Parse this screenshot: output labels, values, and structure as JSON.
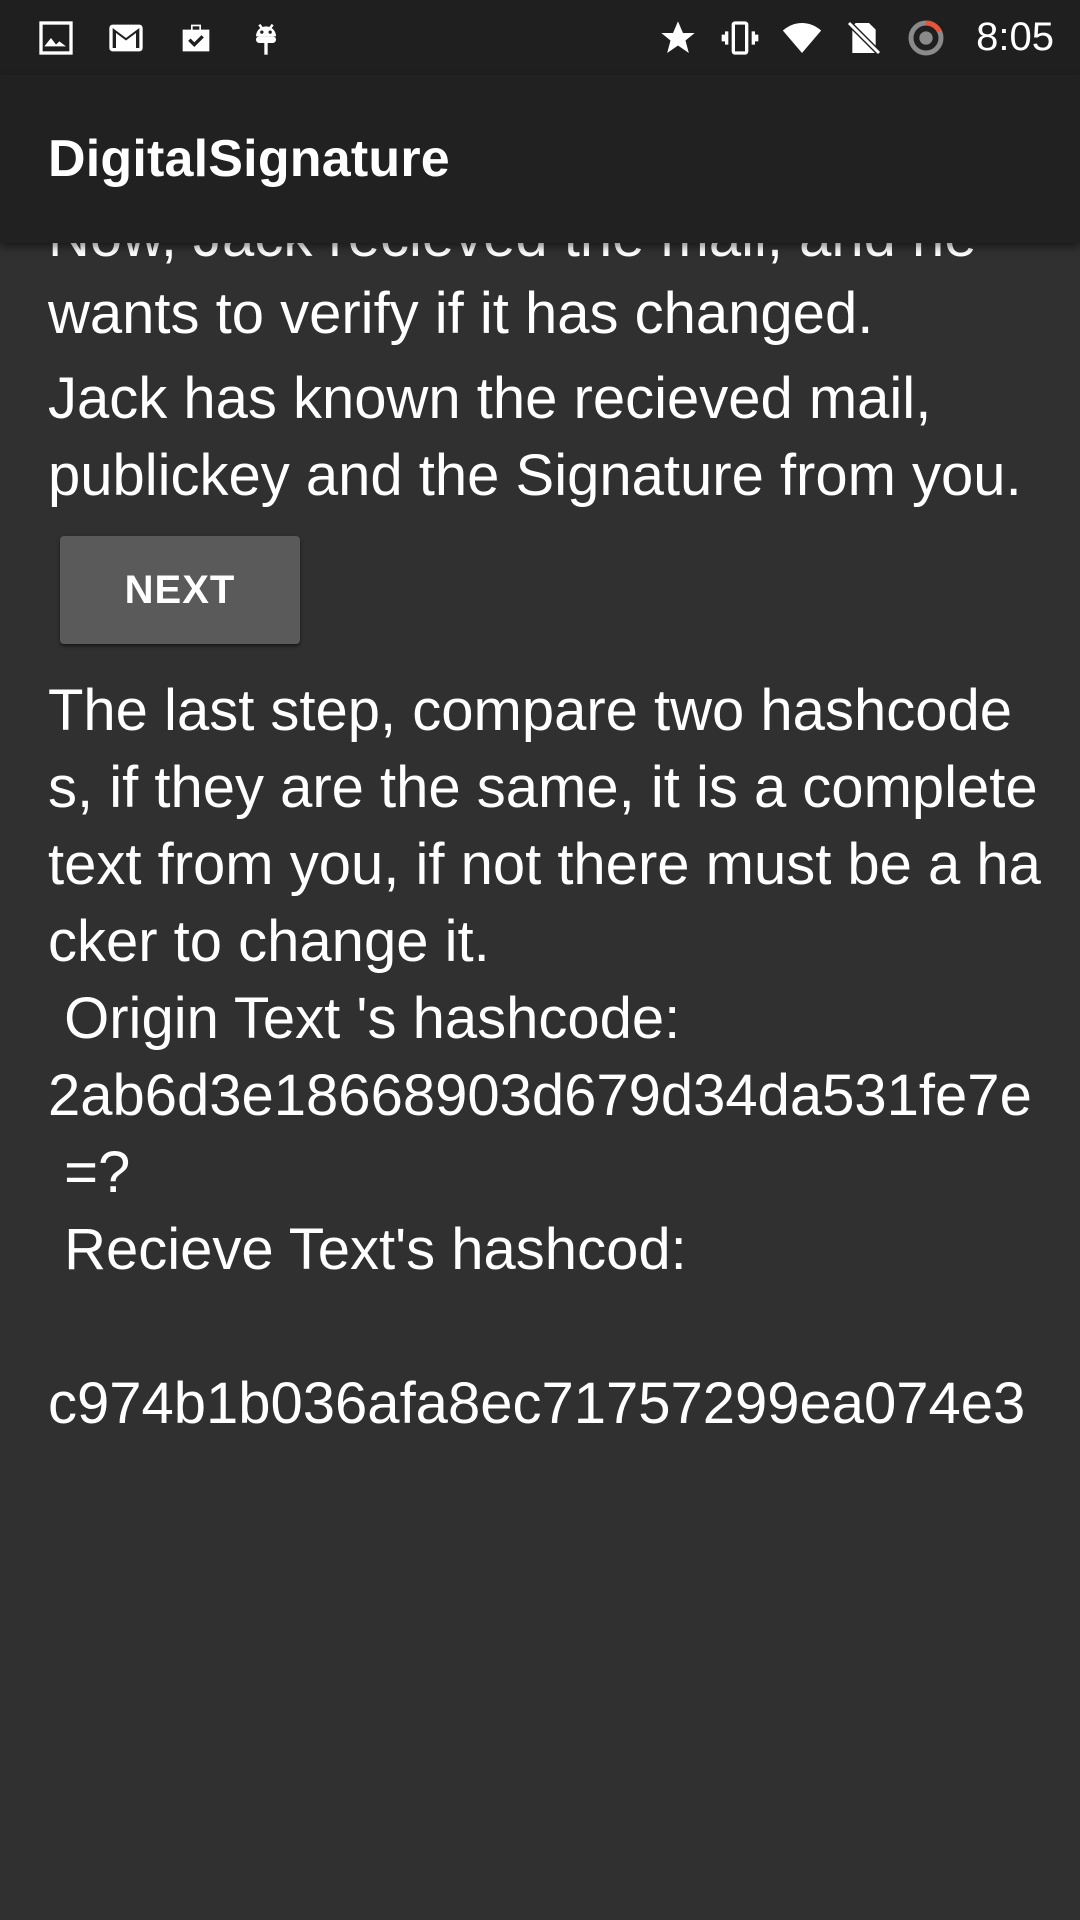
{
  "status_bar": {
    "time": "8:05",
    "left_icons": [
      "image-icon",
      "gmail-icon",
      "briefcase-check-icon",
      "android-icon"
    ],
    "right_icons": [
      "star-icon",
      "vibrate-icon",
      "wifi-icon",
      "no-sim-icon",
      "sync-circle-icon"
    ]
  },
  "app_bar": {
    "title": "DigitalSignature"
  },
  "content": {
    "para1": "Now, Jack recieved the mail, and he wants to verify if it has changed.",
    "para2": "Jack has known the recieved mail, publickey and the Signature from you.",
    "next_button": "NEXT",
    "result": "The last step, compare two hashcodes, if they are the same, it is a complete text from you, if not there must be a hacker to change it.\n Origin Text 's hashcode:\n2ab6d3e18668903d679d34da531fe7e\n =?\n Recieve Text's hashcod:\n\nc974b1b036afa8ec71757299ea074e3"
  },
  "colors": {
    "background": "#303030",
    "app_bar": "#212121",
    "status_bar": "#1f1f1f",
    "button": "#5a5a5a",
    "text": "#ffffff"
  }
}
